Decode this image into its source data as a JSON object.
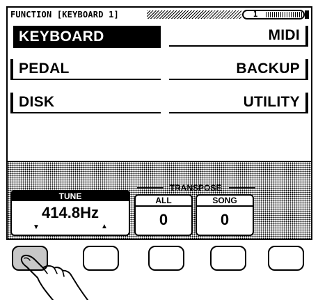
{
  "header": {
    "title": "FUNCTION [KEYBOARD 1]",
    "page_number": "1"
  },
  "menu": {
    "left": [
      {
        "label": "KEYBOARD",
        "selected": true
      },
      {
        "label": "PEDAL",
        "selected": false
      },
      {
        "label": "DISK",
        "selected": false
      }
    ],
    "right": [
      {
        "label": "MIDI"
      },
      {
        "label": "BACKUP"
      },
      {
        "label": "UTILITY"
      }
    ]
  },
  "params": {
    "tune": {
      "label": "TUNE",
      "value": "414.8Hz"
    },
    "transpose": {
      "label": "TRANSPOSE",
      "all": {
        "label": "ALL",
        "value": "0"
      },
      "song": {
        "label": "SONG",
        "value": "0"
      }
    }
  },
  "hardware_buttons": {
    "count": 5,
    "pressed_index": 0
  },
  "colors": {
    "lcd_bg": "#ffffff",
    "ink": "#000000",
    "pressed_button": "#c8c8c8"
  }
}
